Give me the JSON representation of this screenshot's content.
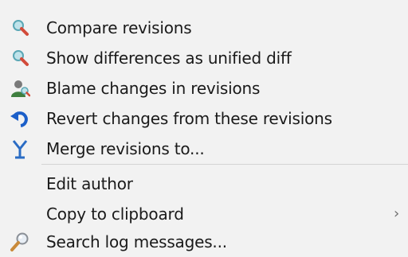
{
  "menu": {
    "items": [
      {
        "label": "Compare revisions",
        "icon": "magnifier-compare-icon"
      },
      {
        "label": "Show differences as unified diff",
        "icon": "magnifier-diff-icon"
      },
      {
        "label": "Blame changes in revisions",
        "icon": "blame-person-icon"
      },
      {
        "label": "Revert changes from these revisions",
        "icon": "revert-arrow-icon"
      },
      {
        "label": "Merge revisions to...",
        "icon": "merge-icon"
      },
      {
        "label": "Edit author",
        "icon": ""
      },
      {
        "label": "Copy to clipboard",
        "icon": "",
        "submenu_arrow": "›"
      },
      {
        "label": "Search log messages...",
        "icon": "search-log-icon"
      }
    ]
  },
  "colors": {
    "background": "#f2f2f2",
    "text": "#1a1a1a",
    "separator": "#d4d4d4",
    "revert_blue": "#1c5fc9",
    "merge_blue": "#2b6cc4",
    "magnifier_red": "#d24b3a",
    "magnifier_teal": "#5aa7b5"
  }
}
